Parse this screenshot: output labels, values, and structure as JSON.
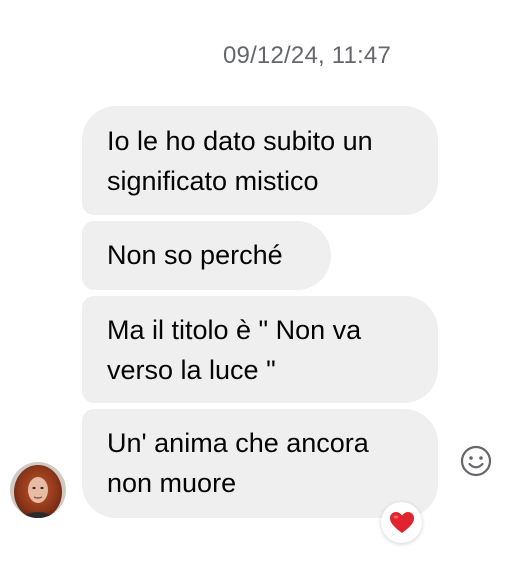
{
  "conversation": {
    "timestamp": "09/12/24, 11:47",
    "messages": [
      {
        "text": "Io le ho dato subito un\nsignificato mistico"
      },
      {
        "text": "Non so perché"
      },
      {
        "text": "Ma il titolo è \" Non va\nverso la luce \""
      },
      {
        "text": "Un' anima che ancora\nnon muore"
      }
    ],
    "last_message_reaction": "heart-icon",
    "colors": {
      "bubble_background": "#efefef",
      "timestamp": "#65676b",
      "reaction_heart": "#e0242f"
    }
  }
}
